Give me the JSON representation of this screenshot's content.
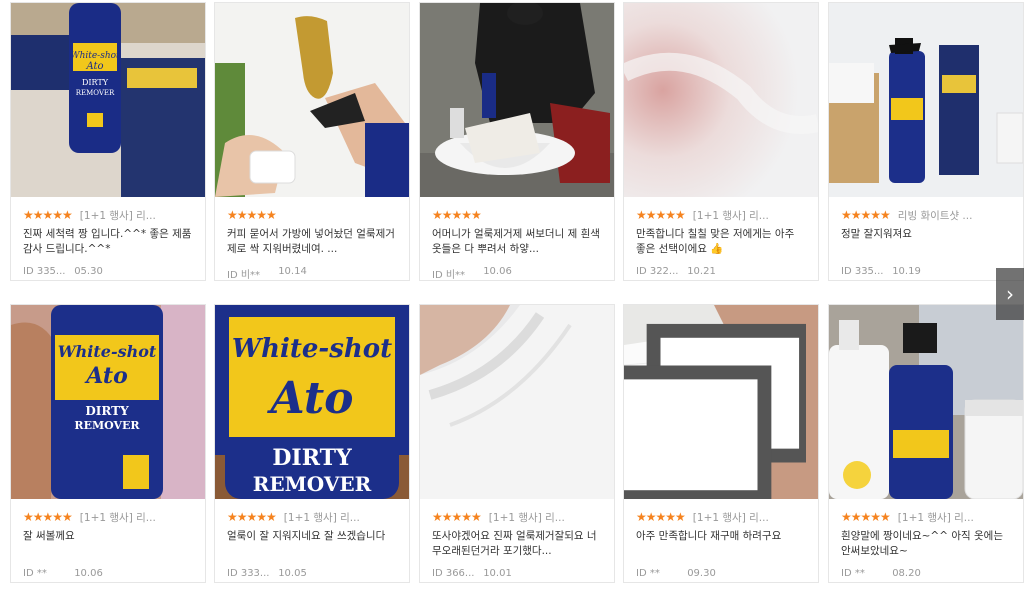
{
  "nav": {
    "next_glyph": "›"
  },
  "reviews": [
    {
      "stars": "★★★★★",
      "option": "[1+1 행사] 리...",
      "text": "진짜 세척력 짱 입니다.^^* 좋은 제품 감사 드립니다.^^*",
      "user": "ID 335...",
      "date": "05.30"
    },
    {
      "stars": "★★★★★",
      "option": "",
      "text": "커피 묻어서 가방에 넣어놨던 얼룩제거제로 싹 지워버렸네여. ...",
      "user": "ID 비**",
      "date": "10.14"
    },
    {
      "stars": "★★★★★",
      "option": "",
      "text": "어머니가 얼룩제거제 써보더니 제 흰색옷들은 다 뿌려서 하얗...",
      "user": "ID 비**",
      "date": "10.06"
    },
    {
      "stars": "★★★★★",
      "option": "[1+1 행사] 리...",
      "text": "만족합니다 칠칠 맞은 저에게는 아주 좋은 선택이에요 👍",
      "user": "ID 322...",
      "date": "10.21"
    },
    {
      "stars": "★★★★★",
      "option": "리빙 화이트샷 ...",
      "text": "정말 잘지워져요",
      "user": "ID 335...",
      "date": "10.19"
    },
    {
      "stars": "★★★★★",
      "option": "[1+1 행사] 리...",
      "text": "잘 써볼께요",
      "user": "ID **",
      "date": "10.06"
    },
    {
      "stars": "★★★★★",
      "option": "[1+1 행사] 리...",
      "text": "얼룩이 잘 지워지네요 잘 쓰겠습니다",
      "user": "ID 333...",
      "date": "10.05"
    },
    {
      "stars": "★★★★★",
      "option": "[1+1 행사] 리...",
      "text": "또사야겠어요 진짜 얼룩제거잘되요 너무오래된던거라 포기했다...",
      "user": "ID 366...",
      "date": "10.01"
    },
    {
      "stars": "★★★★★",
      "option": "[1+1 행사] 리...",
      "text": "아주 만족합니다 재구매 하려구요",
      "user": "ID **",
      "date": "09.30"
    },
    {
      "stars": "★★★★★",
      "option": "[1+1 행사] 리...",
      "text": "흰양말에 짱이네요~^^ 아직 옷에는 안써보았네요~",
      "user": "ID **",
      "date": "08.20"
    }
  ],
  "photo_labels": {
    "brand_line1": "White-shot",
    "brand_line2": "Ato",
    "product_line1": "DIRTY",
    "product_line2": "REMOVER"
  },
  "colors": {
    "star": "#f5831f",
    "bottle_blue": "#1c2f8a",
    "label_yellow": "#f2c71b"
  }
}
